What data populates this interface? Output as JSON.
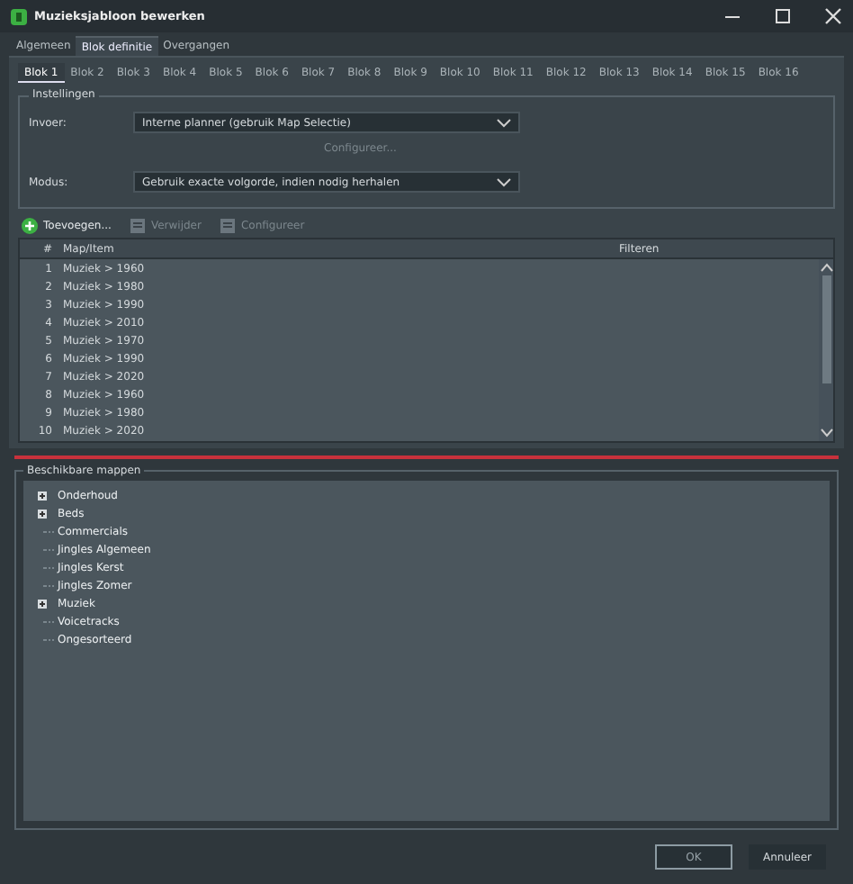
{
  "window": {
    "title": "Muzieksjabloon bewerken"
  },
  "tabs": [
    {
      "label": "Algemeen",
      "selected": false
    },
    {
      "label": "Blok definitie",
      "selected": true
    },
    {
      "label": "Overgangen",
      "selected": false
    }
  ],
  "block_tabs": [
    {
      "label": "Blok 1",
      "selected": true
    },
    {
      "label": "Blok 2",
      "selected": false
    },
    {
      "label": "Blok 3",
      "selected": false
    },
    {
      "label": "Blok 4",
      "selected": false
    },
    {
      "label": "Blok 5",
      "selected": false
    },
    {
      "label": "Blok 6",
      "selected": false
    },
    {
      "label": "Blok 7",
      "selected": false
    },
    {
      "label": "Blok 8",
      "selected": false
    },
    {
      "label": "Blok 9",
      "selected": false
    },
    {
      "label": "Blok 10",
      "selected": false
    },
    {
      "label": "Blok 11",
      "selected": false
    },
    {
      "label": "Blok 12",
      "selected": false
    },
    {
      "label": "Blok 13",
      "selected": false
    },
    {
      "label": "Blok 14",
      "selected": false
    },
    {
      "label": "Blok 15",
      "selected": false
    },
    {
      "label": "Blok 16",
      "selected": false
    }
  ],
  "settings": {
    "title": "Instellingen",
    "input_label": "Invoer:",
    "input_value": "Interne planner (gebruik Map Selectie)",
    "configure_button": {
      "label": "Configureer...",
      "disabled": true
    },
    "mode_label": "Modus:",
    "mode_value": "Gebruik exacte volgorde, indien nodig herhalen"
  },
  "toolbar": [
    {
      "label": "Toevoegen...",
      "disabled": false
    },
    {
      "label": "Verwijder",
      "disabled": true
    },
    {
      "label": "Configureer",
      "disabled": true
    }
  ],
  "table": {
    "columns": [
      "#",
      "Map/Item",
      "Filteren"
    ],
    "rows": [
      [
        "1",
        "Muziek > 1960"
      ],
      [
        "2",
        "Muziek > 1980"
      ],
      [
        "3",
        "Muziek > 1990"
      ],
      [
        "4",
        "Muziek > 2010"
      ],
      [
        "5",
        "Muziek > 1970"
      ],
      [
        "6",
        "Muziek > 1990"
      ],
      [
        "7",
        "Muziek > 2020"
      ],
      [
        "8",
        "Muziek > 1960"
      ],
      [
        "9",
        "Muziek > 1980"
      ],
      [
        "10",
        "Muziek > 2020"
      ]
    ]
  },
  "folders": {
    "title": "Beschikbare mappen",
    "items": [
      {
        "label": "Onderhoud",
        "kind": "group",
        "expanded": false
      },
      {
        "label": "Beds",
        "kind": "group",
        "expanded": false
      },
      {
        "label": "Commercials",
        "kind": "leaf"
      },
      {
        "label": "Jingles Algemeen",
        "kind": "leaf"
      },
      {
        "label": "Jingles Kerst",
        "kind": "leaf"
      },
      {
        "label": "Jingles Zomer",
        "kind": "leaf"
      },
      {
        "label": "Muziek",
        "kind": "group",
        "expanded": false
      },
      {
        "label": "Voicetracks",
        "kind": "leaf"
      },
      {
        "label": "Ongesorteerd",
        "kind": "leaf"
      }
    ]
  },
  "buttons": [
    {
      "label": "OK",
      "kind": "default"
    },
    {
      "label": "Annuleer",
      "kind": "normal"
    }
  ]
}
